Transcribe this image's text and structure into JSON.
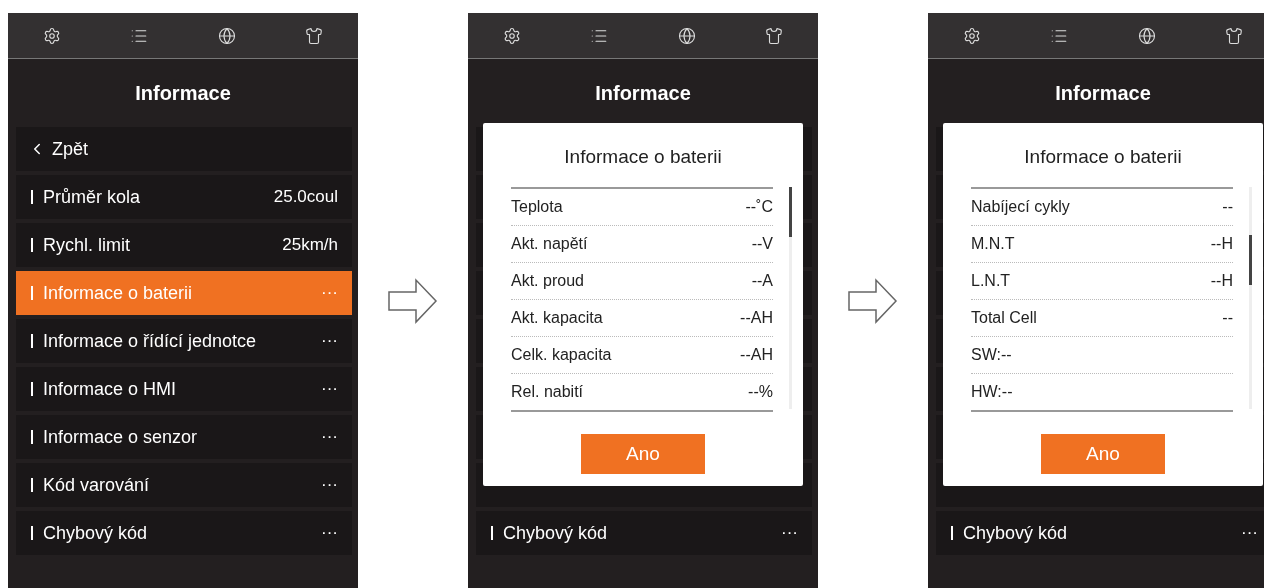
{
  "screens": [
    {
      "title": "Informace",
      "menu": [
        {
          "kind": "back",
          "label": "Zpět",
          "selected": false
        },
        {
          "kind": "item",
          "label": "Průměr kola",
          "value": "25.0coul",
          "selected": false
        },
        {
          "kind": "item",
          "label": "Rychl. limit",
          "value": "25km/h",
          "selected": false
        },
        {
          "kind": "item",
          "label": "Informace o baterii",
          "value": "···",
          "selected": true
        },
        {
          "kind": "item",
          "label": "Informace o řídící jednotce",
          "value": "···",
          "selected": false
        },
        {
          "kind": "item",
          "label": "Informace o HMI",
          "value": "···",
          "selected": false
        },
        {
          "kind": "item",
          "label": "Informace o senzor",
          "value": "···",
          "selected": false
        },
        {
          "kind": "item",
          "label": "Kód varování",
          "value": "···",
          "selected": false
        },
        {
          "kind": "item",
          "label": "Chybový kód",
          "value": "···",
          "selected": false
        }
      ]
    },
    {
      "title": "Informace",
      "menu": [
        {
          "kind": "covered",
          "selected": false
        },
        {
          "kind": "covered",
          "selected": false
        },
        {
          "kind": "covered",
          "selected": false
        },
        {
          "kind": "covered",
          "selected": false
        },
        {
          "kind": "covered",
          "selected": false
        },
        {
          "kind": "covered",
          "selected": false
        },
        {
          "kind": "covered",
          "selected": false
        },
        {
          "kind": "covered",
          "selected": false
        },
        {
          "kind": "item",
          "label": "Chybový kód",
          "value": "···",
          "selected": false
        }
      ],
      "dialog": {
        "title": "Informace o baterii",
        "scrolled": false,
        "rows": [
          {
            "label": "Teplota",
            "value": "--˚C"
          },
          {
            "label": "Akt. napětí",
            "value": "--V"
          },
          {
            "label": "Akt. proud",
            "value": "--A"
          },
          {
            "label": "Akt. kapacita",
            "value": "--AH"
          },
          {
            "label": "Celk. kapacita",
            "value": "--AH"
          },
          {
            "label": "Rel. nabití",
            "value": "--%"
          }
        ],
        "button": "Ano"
      }
    },
    {
      "title": "Informace",
      "menu": [
        {
          "kind": "covered",
          "selected": false
        },
        {
          "kind": "covered",
          "selected": false
        },
        {
          "kind": "covered",
          "selected": false
        },
        {
          "kind": "covered",
          "selected": false
        },
        {
          "kind": "covered",
          "selected": false
        },
        {
          "kind": "covered",
          "selected": false
        },
        {
          "kind": "covered",
          "selected": false
        },
        {
          "kind": "covered",
          "selected": false
        },
        {
          "kind": "item",
          "label": "Chybový kód",
          "value": "···",
          "selected": false
        }
      ],
      "dialog": {
        "title": "Informace o baterii",
        "scrolled": true,
        "rows": [
          {
            "label": "Nabíjecí cykly",
            "value": "--"
          },
          {
            "label": "M.N.T",
            "value": "--H"
          },
          {
            "label": "L.N.T",
            "value": "--H"
          },
          {
            "label": "Total Cell",
            "value": "--"
          },
          {
            "label": "SW:--"
          },
          {
            "label": "HW:--"
          }
        ],
        "button": "Ano"
      }
    }
  ]
}
